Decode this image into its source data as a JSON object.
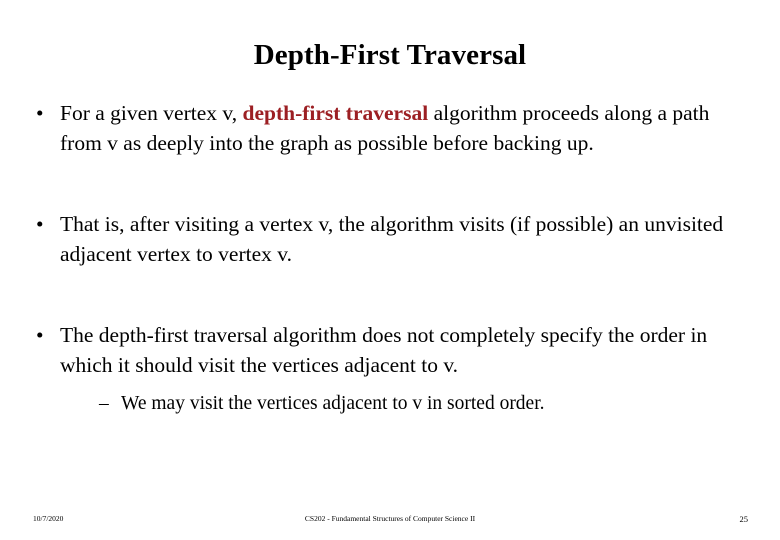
{
  "slide": {
    "title": "Depth-First Traversal",
    "bullet_marker": "•",
    "sub_bullet_marker": "–",
    "accent_color": "#9C1F23",
    "bullets": [
      {
        "lead": "For a given vertex v, ",
        "emphasis": "depth-first traversal",
        "tail": " algorithm proceeds along a path from v as deeply into the graph as possible before backing up."
      },
      {
        "lead": "That is, after visiting a vertex v, the algorithm visits (if possible) an unvisited adjacent vertex to vertex v.",
        "emphasis": "",
        "tail": ""
      },
      {
        "lead": "The depth-first traversal algorithm does not completely specify the order in which it should visit the vertices adjacent to v.",
        "emphasis": "",
        "tail": ""
      }
    ],
    "sub_bullet": "We may visit the vertices adjacent to v in sorted order."
  },
  "footer": {
    "date": "10/7/2020",
    "course": "CS202 - Fundamental Structures of Computer Science II",
    "page_number": "25"
  }
}
